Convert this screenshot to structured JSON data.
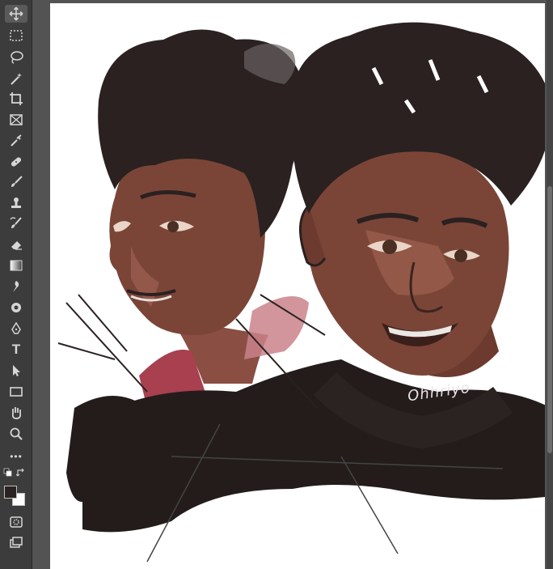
{
  "toolbar": {
    "tools": [
      {
        "icon": "move-icon",
        "active": true
      },
      {
        "icon": "rect-marquee-icon"
      },
      {
        "icon": "lasso-icon"
      },
      {
        "icon": "magic-wand-icon"
      },
      {
        "icon": "crop-icon"
      },
      {
        "icon": "frame-icon"
      },
      {
        "icon": "eyedropper-icon"
      },
      {
        "icon": "healing-brush-icon"
      },
      {
        "icon": "brush-icon"
      },
      {
        "icon": "clone-stamp-icon"
      },
      {
        "icon": "history-brush-icon"
      },
      {
        "icon": "eraser-icon"
      },
      {
        "icon": "gradient-icon"
      },
      {
        "icon": "smudge-icon"
      },
      {
        "icon": "dodge-icon"
      },
      {
        "icon": "pen-icon"
      },
      {
        "icon": "type-icon",
        "glyph": "T"
      },
      {
        "icon": "path-select-icon"
      },
      {
        "icon": "rectangle-shape-icon"
      },
      {
        "icon": "hand-icon"
      },
      {
        "icon": "zoom-icon"
      },
      {
        "icon": "more-tools-icon",
        "glyph": "•••"
      }
    ],
    "foreground_color": "#2b2321",
    "background_color": "#ffffff"
  },
  "canvas": {
    "signature_text": "Ohhriyo"
  },
  "colors": {
    "skin": "#7a4537",
    "skin_light": "#9a5d4b",
    "hair": "#2a2120",
    "accent": "#a8404f"
  }
}
